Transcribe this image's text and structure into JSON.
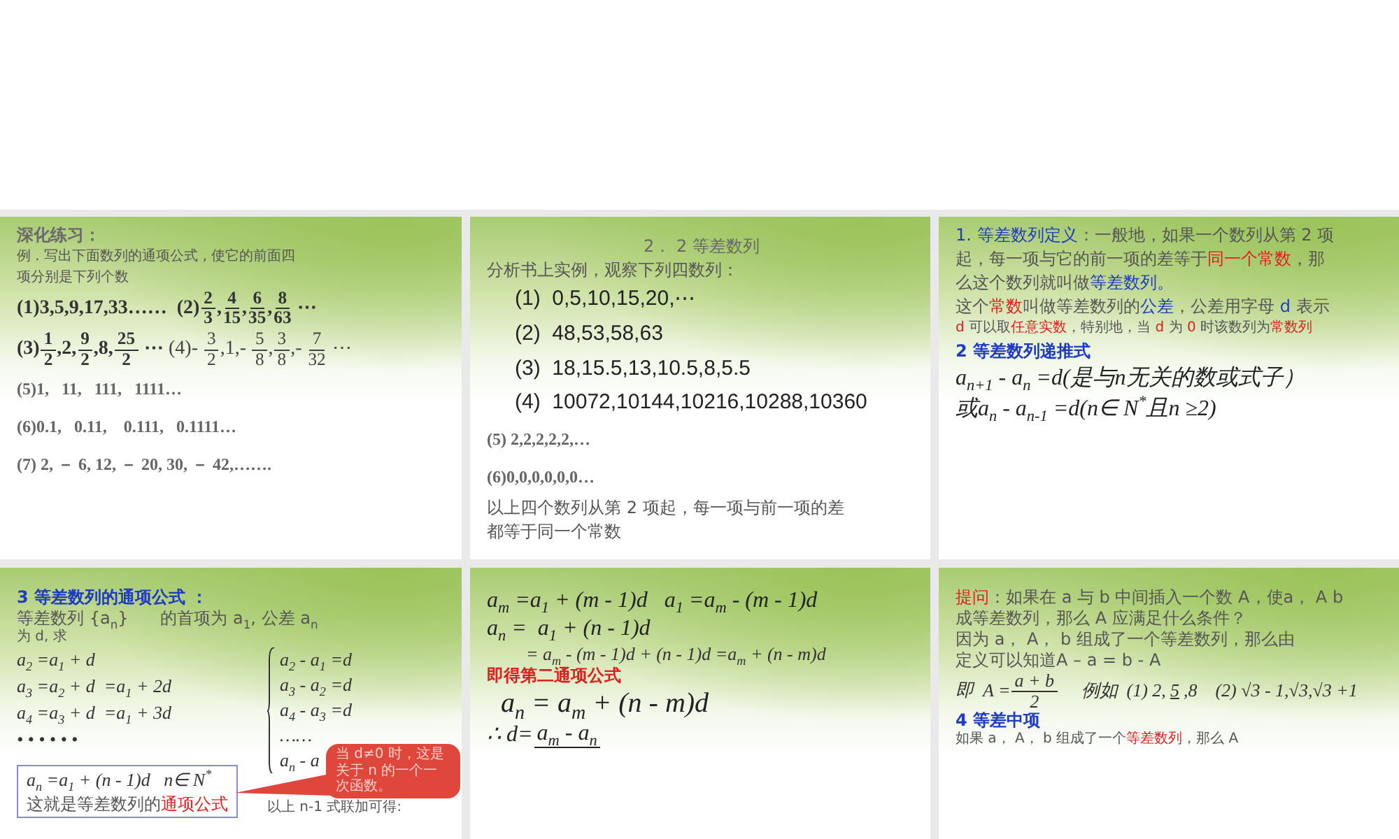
{
  "slides": [
    {
      "selected": false,
      "blocks": [
        {
          "kind": "heading",
          "text": "深化练习：",
          "color": "#6a6a6a"
        },
        {
          "kind": "note",
          "text": "例 . 写出下面数列的通项公式 , 使它的前面四"
        },
        {
          "kind": "note",
          "text": "项分别是下列个数"
        },
        {
          "kind": "seq",
          "segs": [
            {
              "kind": "text",
              "text": "(1)3,5,9,17,33……  (2)"
            },
            {
              "kind": "frac",
              "num": "2",
              "den": "3"
            },
            {
              "kind": "text",
              "text": ","
            },
            {
              "kind": "frac",
              "num": "4",
              "den": "15"
            },
            {
              "kind": "text",
              "text": ","
            },
            {
              "kind": "frac",
              "num": "6",
              "den": "35"
            },
            {
              "kind": "text",
              "text": ","
            },
            {
              "kind": "frac",
              "num": "8",
              "den": "63"
            },
            {
              "kind": "text",
              "text": " ⋯"
            }
          ]
        },
        {
          "kind": "seq",
          "segs": [
            {
              "kind": "text",
              "text": "(3)"
            },
            {
              "kind": "frac",
              "num": "1",
              "den": "2"
            },
            {
              "kind": "text",
              "text": ",2,"
            },
            {
              "kind": "frac",
              "num": "9",
              "den": "2"
            },
            {
              "kind": "text",
              "text": ",8,"
            },
            {
              "kind": "frac",
              "num": "25",
              "den": "2"
            },
            {
              "kind": "text",
              "text": " ⋯ "
            },
            {
              "kind": "text",
              "text": "(4)- ",
              "plain": true
            },
            {
              "kind": "frac",
              "num": "3",
              "den": "2",
              "plain": true
            },
            {
              "kind": "text",
              "text": ",1,- ",
              "plain": true
            },
            {
              "kind": "frac",
              "num": "5",
              "den": "8",
              "plain": true
            },
            {
              "kind": "text",
              "text": ",",
              "plain": true
            },
            {
              "kind": "frac",
              "num": "3",
              "den": "8",
              "plain": true
            },
            {
              "kind": "text",
              "text": ",- ",
              "plain": true
            },
            {
              "kind": "frac",
              "num": "7",
              "den": "32",
              "plain": true
            },
            {
              "kind": "text",
              "text": " ⋯",
              "plain": true
            }
          ]
        },
        {
          "kind": "seq-small",
          "text": "(5)1,   11,   111,   1111…"
        },
        {
          "kind": "seq-small",
          "text": "(6)0.1,   0.11,    0.111,   0.1111…"
        },
        {
          "kind": "seq-small",
          "text": "(7) 2, － 6, 12, － 20, 30, － 42,……."
        }
      ]
    },
    {
      "selected": false,
      "blocks": [
        {
          "kind": "title",
          "text": "2． 2 等差数列"
        },
        {
          "kind": "body",
          "text": "分析书上实例，观察下列四数列："
        },
        {
          "kind": "big",
          "text": "(1)  0,5,10,15,20,⋯"
        },
        {
          "kind": "big",
          "text": "(2)  48,53,58,63"
        },
        {
          "kind": "big",
          "text": "(3)  18,15.5,13,10.5,8,5.5"
        },
        {
          "kind": "big",
          "text": "(4)  10072,10144,10216,10288,10360"
        },
        {
          "kind": "seq-small",
          "text": "(5) 2,2,2,2,2,…"
        },
        {
          "kind": "seq-small",
          "text": "(6)0,0,0,0,0,0…"
        },
        {
          "kind": "body",
          "text": "以上四个数列从第 2 项起，每一项与前一项的差"
        },
        {
          "kind": "body",
          "text": "都等于同一个常数"
        }
      ]
    },
    {
      "selected": false,
      "blocks": [
        {
          "kind": "body",
          "segs": [
            {
              "kind": "text",
              "text": "1. 等差数列定义",
              "color": "#1f3cc0"
            },
            {
              "kind": "text",
              "text": "：一般地，如果一个数列从第 2 项"
            }
          ]
        },
        {
          "kind": "body",
          "segs": [
            {
              "kind": "text",
              "text": "起，每一项与它的前一项的差等于"
            },
            {
              "kind": "text",
              "text": "同一个常数",
              "color": "#e02020"
            },
            {
              "kind": "text",
              "text": "，那"
            }
          ]
        },
        {
          "kind": "body",
          "segs": [
            {
              "kind": "text",
              "text": "么这个数列就叫做"
            },
            {
              "kind": "text",
              "text": "等差数列。",
              "color": "#1f3cc0"
            }
          ]
        },
        {
          "kind": "body",
          "segs": [
            {
              "kind": "text",
              "text": "这个"
            },
            {
              "kind": "text",
              "text": "常数",
              "color": "#e02020"
            },
            {
              "kind": "text",
              "text": "叫做等差数列的"
            },
            {
              "kind": "text",
              "text": "公差",
              "color": "#1f3cc0"
            },
            {
              "kind": "text",
              "text": "，公差用字母 "
            },
            {
              "kind": "text",
              "text": "d",
              "color": "#1f3cc0"
            },
            {
              "kind": "text",
              "text": " 表示"
            }
          ]
        },
        {
          "kind": "note",
          "segs": [
            {
              "kind": "text",
              "text": "d",
              "color": "#e02020"
            },
            {
              "kind": "text",
              "text": " 可以取"
            },
            {
              "kind": "text",
              "text": "任意实数",
              "color": "#e02020"
            },
            {
              "kind": "text",
              "text": "，特别地，当 "
            },
            {
              "kind": "text",
              "text": "d",
              "color": "#e02020"
            },
            {
              "kind": "text",
              "text": " 为 "
            },
            {
              "kind": "text",
              "text": "0",
              "color": "#e02020"
            },
            {
              "kind": "text",
              "text": " 时该数列为"
            },
            {
              "kind": "text",
              "text": "常数列",
              "color": "#e02020"
            }
          ]
        },
        {
          "kind": "heading",
          "text": "2 等差数列递推式",
          "color": "#1f3cc0"
        },
        {
          "kind": "math",
          "text": "a$_{n+1}$ - a$_{n}$ =d(是与n无关的数或式子）"
        },
        {
          "kind": "math",
          "text": "或a$_{n}$ - a$_{n-1}$ =d(n∈ N$^{*}$且n ≥2)"
        }
      ]
    },
    {
      "selected": false,
      "blocks": [
        {
          "kind": "heading",
          "text": "3 等差数列的通项公式 ：",
          "color": "#1f3cc0"
        },
        {
          "kind": "body",
          "text": "等差数列 {a$_{n}$}      的首项为 a$_{1}$, 公差 a$_{n}$"
        },
        {
          "kind": "note",
          "text": "为 d, 求"
        },
        {
          "kind": "split",
          "brace": true,
          "left": [
            {
              "kind": "math-small",
              "text": "a$_{2}$ =a$_{1}$ + d"
            },
            {
              "kind": "math-small",
              "text": "a$_{3}$ =a$_{2}$ + d  =a$_{1}$ + 2d"
            },
            {
              "kind": "math-small",
              "text": "a$_{4}$ =a$_{3}$ + d  =a$_{1}$ + 3d"
            },
            {
              "kind": "math-small",
              "text": "• • • • • •"
            }
          ],
          "right": [
            {
              "kind": "math-small",
              "text": "a$_{2}$ - a$_{1}$ =d"
            },
            {
              "kind": "math-small",
              "text": "a$_{3}$ - a$_{2}$ =d"
            },
            {
              "kind": "math-small",
              "text": "a$_{4}$ - a$_{3}$ =d"
            },
            {
              "kind": "math-small",
              "text": "……"
            },
            {
              "kind": "math-small",
              "text": "a$_{n}$ - a"
            }
          ]
        },
        {
          "kind": "split",
          "brace": false,
          "left": [
            {
              "kind": "boxed",
              "lines": [
                {
                  "kind": "math-small",
                  "text": "a$_{n}$ =a$_{1}$ + (n - 1)d   n∈ N$^{*}$"
                },
                {
                  "kind": "body",
                  "segs": [
                    {
                      "kind": "text",
                      "text": "这就是等差数列的"
                    },
                    {
                      "kind": "text",
                      "text": "通项公式",
                      "color": "#e02020"
                    }
                  ]
                }
              ]
            }
          ],
          "right": [
            {
              "kind": "note",
              "text": "以上 n-1 式联加可得:"
            }
          ]
        },
        {
          "kind": "callout",
          "text": "当 d≠0 时，这是关于 n 的一个一次函数。"
        }
      ]
    },
    {
      "selected": false,
      "blocks": [
        {
          "kind": "math",
          "text": "a$_{m}$ =a$_{1}$ + (m - 1)d   a$_{1}$ =a$_{m}$ - (m - 1)d"
        },
        {
          "kind": "math",
          "text": "a$_{n}$ =  a$_{1}$ + (n - 1)d"
        },
        {
          "kind": "math-indent",
          "text": "= a$_{m}$ - (m - 1)d + (n - 1)d =a$_{m}$ + (n - m)d"
        },
        {
          "kind": "heading",
          "text": "即得第二通项公式",
          "color": "#e02020"
        },
        {
          "kind": "math-big",
          "text": "a$_{n}$ = a$_{m}$ + (n - m)d"
        },
        {
          "kind": "math",
          "segs": [
            {
              "kind": "text",
              "text": "∴ d="
            },
            {
              "kind": "frac",
              "num": "a$_{m}$ - a$_{n}$"
            }
          ]
        }
      ]
    },
    {
      "selected": false,
      "blocks": [
        {
          "kind": "body",
          "segs": [
            {
              "kind": "text",
              "text": "提问",
              "color": "#e02020"
            },
            {
              "kind": "text",
              "text": "：如果在 a 与 b 中间插入一个数 A，使a， A b"
            }
          ]
        },
        {
          "kind": "body",
          "text": "成等差数列，那么 A 应满足什么条件？"
        },
        {
          "kind": "body",
          "text": "因为 a， A， b 组成了一个等差数列，那么由"
        },
        {
          "kind": "body",
          "text": "定义可以知道A – a = b - A"
        },
        {
          "kind": "math-small",
          "segs": [
            {
              "kind": "text",
              "text": "即  A ="
            },
            {
              "kind": "frac",
              "num": "a + b",
              "den": "2"
            },
            {
              "kind": "text",
              "text": "     例如  (1) 2,"
            },
            {
              "kind": "blank",
              "text": "5"
            },
            {
              "kind": "text",
              "text": ",8    (2) √3 - 1,√3,√3 +1"
            }
          ]
        },
        {
          "kind": "heading",
          "text": "4 等差中项",
          "color": "#1f3cc0"
        },
        {
          "kind": "note",
          "segs": [
            {
              "kind": "text",
              "text": "如果 a， A， b 组成了一个"
            },
            {
              "kind": "text",
              "text": "等差数列",
              "color": "#e02020"
            },
            {
              "kind": "text",
              "text": "，那么 A"
            }
          ]
        }
      ]
    }
  ]
}
